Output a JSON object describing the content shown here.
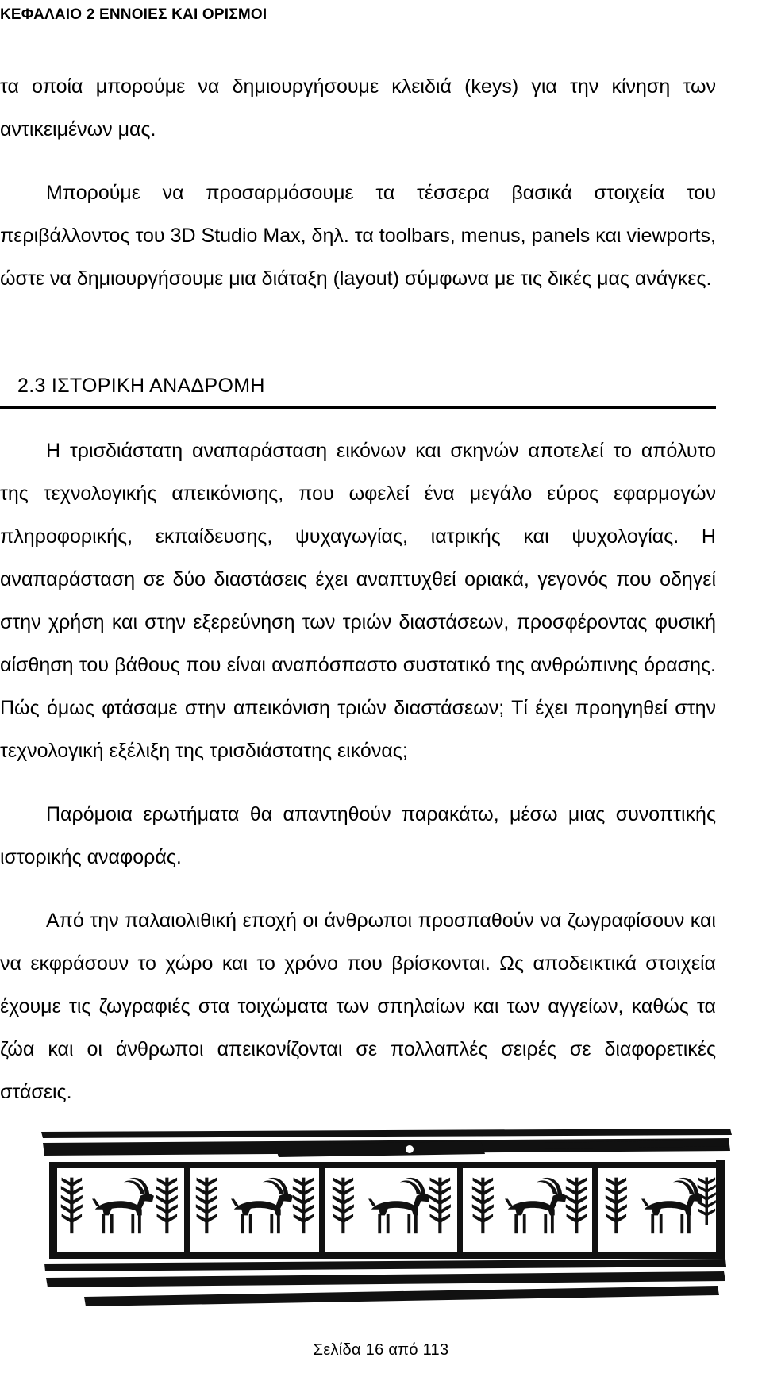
{
  "header": {
    "running_title": "ΚΕΦΑΛΑΙΟ 2 ΕΝΝΟΙΕΣ ΚΑΙ ΟΡΙΣΜΟΙ"
  },
  "body": {
    "paragraph_1": "τα οποία μπορούμε να δημιουργήσουμε κλειδιά (keys) για την κίνηση των αντικειμένων μας.",
    "paragraph_2": "Μπορούμε να προσαρμόσουμε τα τέσσερα βασικά στοιχεία του περιβάλλοντος του 3D Studio Max, δηλ. τα toolbars, menus, panels και viewports, ώστε να δημιουργήσουμε μια διάταξη (layout) σύμφωνα με τις δικές μας ανάγκες.",
    "section_number_title": "2.3  ΙΣΤΟΡΙΚΗ ΑΝΑΔΡΟΜΗ",
    "paragraph_3": "Η τρισδιάστατη αναπαράσταση εικόνων και σκηνών αποτελεί το απόλυτο της τεχνολογικής απεικόνισης, που ωφελεί ένα μεγάλο εύρος εφαρμογών πληροφορικής, εκπαίδευσης, ψυχαγωγίας, ιατρικής και ψυχολογίας. Η αναπαράσταση σε δύο διαστάσεις έχει αναπτυχθεί οριακά, γεγονός που οδηγεί στην χρήση και στην εξερεύνηση των τριών διαστάσεων, προσφέροντας φυσική αίσθηση του βάθους που είναι αναπόσπαστο συστατικό της ανθρώπινης όρασης. Πώς όμως φτάσαμε στην απεικόνιση τριών διαστάσεων; Τί έχει προηγηθεί στην τεχνολογική εξέλιξη της τρισδιάστατης εικόνας;",
    "paragraph_4": "Παρόμοια ερωτήματα θα απαντηθούν παρακάτω, μέσω μιας συνοπτικής ιστορικής αναφοράς.",
    "paragraph_5": "Από την παλαιολιθική εποχή οι άνθρωποι προσπαθούν να ζωγραφίσουν και να εκφράσουν το χώρο και το χρόνο που βρίσκονται. Ως αποδεικτικά στοιχεία έχουμε τις ζωγραφιές στα τοιχώματα των σπηλαίων και των αγγείων, καθώς τα ζώα και οι άνθρωποι απεικονίζονται σε πολλαπλές σειρές σε διαφορετικές στάσεις."
  },
  "figure": {
    "caption": "",
    "description": "ancient-vase-frieze-with-ibex-and-tree-panels"
  },
  "footer": {
    "page_label": "Σελίδα 16 από 113"
  },
  "colors": {
    "text": "#000000",
    "background": "#ffffff",
    "rule": "#000000"
  }
}
